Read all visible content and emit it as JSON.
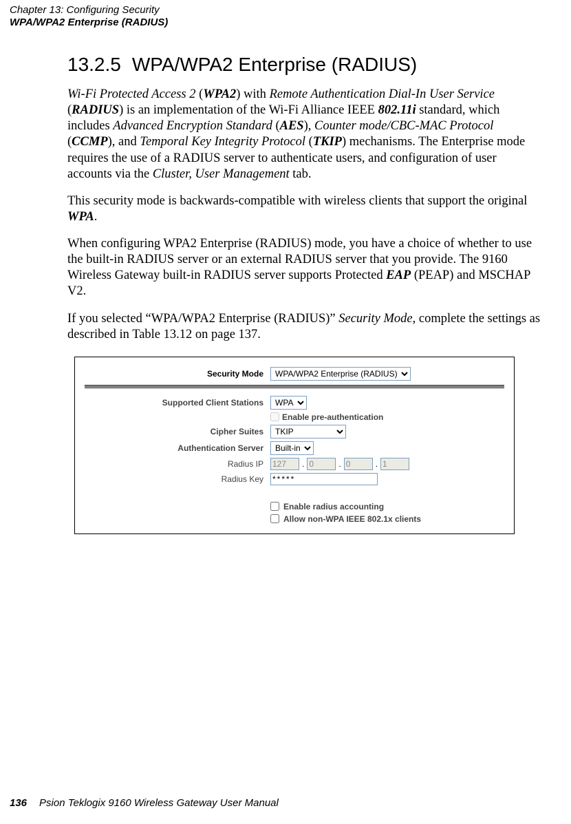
{
  "header": {
    "chapter": "Chapter 13:  Configuring Security",
    "section": "WPA/WPA2 Enterprise (RADIUS)"
  },
  "heading": {
    "number": "13.2.5",
    "title": "WPA/WPA2 Enterprise (RADIUS)"
  },
  "para1": {
    "t1": "Wi-Fi Protected Access 2",
    "t2": " (",
    "t3": "WPA2",
    "t4": ") with ",
    "t5": "Remote Authentication Dial-In User Service",
    "t6": " (",
    "t7": "RADIUS",
    "t8": ") is an implementation of the Wi-Fi Alliance IEEE ",
    "t9": "802.11i",
    "t10": " standard, which includes ",
    "t11": "Advanced Encryption Standard",
    "t12": " (",
    "t13": "AES",
    "t14": "), ",
    "t15": "Counter mode/CBC-MAC Protocol",
    "t16": " (",
    "t17": "CCMP",
    "t18": "), and ",
    "t19": "Temporal Key Integrity Protocol",
    "t20": " (",
    "t21": "TKIP",
    "t22": ") mechanisms. The Enterprise mode requires the use of a RADIUS server to authenticate users, and configuration of user accounts via the ",
    "t23": "Cluster, User Management",
    "t24": " tab."
  },
  "para2": {
    "t1": "This security mode is backwards-compatible with wireless clients that support the original ",
    "t2": "WPA",
    "t3": "."
  },
  "para3": {
    "t1": "When configuring WPA2 Enterprise (RADIUS) mode, you have a choice of whether to use the built-in RADIUS server or an external RADIUS server that you provide. The 9160 Wireless Gateway built-in RADIUS server supports Protected ",
    "t2": "EAP",
    "t3": " (PEAP) and MSCHAP V2."
  },
  "para4": {
    "t1": "If you selected “WPA/WPA2 Enterprise (RADIUS)” ",
    "t2": "Security Mode",
    "t3": ", complete the settings as described in Table 13.12 on page 137."
  },
  "figure": {
    "security_mode_label": "Security Mode",
    "security_mode_value": "WPA/WPA2 Enterprise (RADIUS)",
    "supported_label": "Supported Client Stations",
    "supported_value": "WPA",
    "preauth_label": "Enable pre-authentication",
    "cipher_label": "Cipher Suites",
    "cipher_value": "TKIP",
    "auth_label": "Authentication Server",
    "auth_value": "Built-in",
    "radius_ip_label": "Radius IP",
    "ip1": "127",
    "ip2": "0",
    "ip3": "0",
    "ip4": "1",
    "dot": ".",
    "radius_key_label": "Radius Key",
    "radius_key_value": "*****",
    "accounting_label": "Enable radius accounting",
    "nonwpa_label": "Allow non-WPA IEEE 802.1x clients"
  },
  "footer": {
    "page": "136",
    "text": "Psion Teklogix 9160 Wireless Gateway User Manual"
  }
}
